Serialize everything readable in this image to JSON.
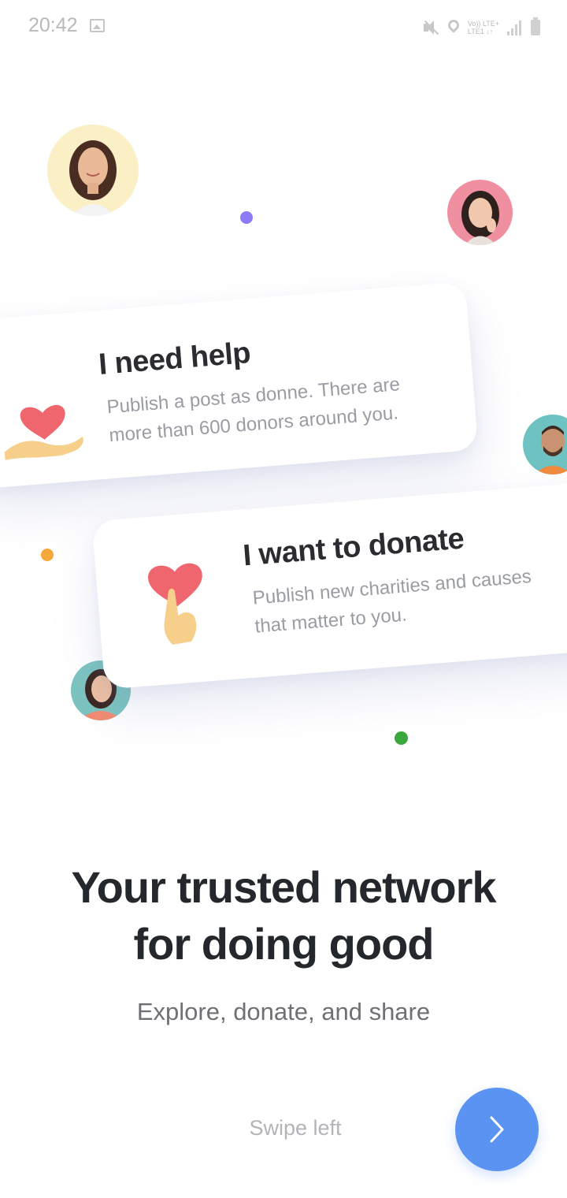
{
  "status_bar": {
    "time": "20:42",
    "network_line1": "Vo)) LTE+",
    "network_line2": "LTE1 ↓↑"
  },
  "cards": [
    {
      "title": "I need help",
      "desc_line1": "Publish a post as donne. There are",
      "desc_line2": "more than 600 donors around you.",
      "icon": "heart-in-hand-icon"
    },
    {
      "title": "I want to donate",
      "desc_line1": "Publish new charities and causes",
      "desc_line2": "that matter to you.",
      "icon": "hand-holding-heart-icon"
    }
  ],
  "headline": {
    "line1": "Your trusted network",
    "line2": "for doing good"
  },
  "subline": "Explore, donate, and share",
  "swipe_hint": "Swipe left",
  "next_button": {
    "icon": "chevron-right-icon"
  },
  "colors": {
    "accent": "#5b93f2",
    "dot_purple": "#8b7cf6",
    "dot_orange": "#f5a93a",
    "dot_green": "#3aa83c",
    "heart": "#f0666e"
  }
}
